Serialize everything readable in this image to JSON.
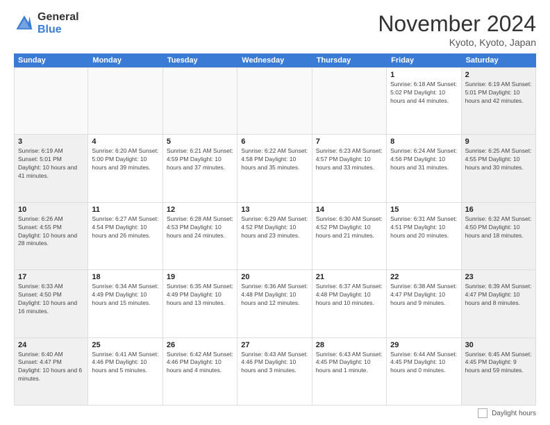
{
  "logo": {
    "general": "General",
    "blue": "Blue"
  },
  "header": {
    "month": "November 2024",
    "location": "Kyoto, Kyoto, Japan"
  },
  "weekdays": [
    "Sunday",
    "Monday",
    "Tuesday",
    "Wednesday",
    "Thursday",
    "Friday",
    "Saturday"
  ],
  "footer": {
    "legend_label": "Daylight hours"
  },
  "weeks": [
    [
      {
        "day": "",
        "info": "",
        "empty": true
      },
      {
        "day": "",
        "info": "",
        "empty": true
      },
      {
        "day": "",
        "info": "",
        "empty": true
      },
      {
        "day": "",
        "info": "",
        "empty": true
      },
      {
        "day": "",
        "info": "",
        "empty": true
      },
      {
        "day": "1",
        "info": "Sunrise: 6:18 AM\nSunset: 5:02 PM\nDaylight: 10 hours and 44 minutes.",
        "empty": false
      },
      {
        "day": "2",
        "info": "Sunrise: 6:19 AM\nSunset: 5:01 PM\nDaylight: 10 hours and 42 minutes.",
        "empty": false
      }
    ],
    [
      {
        "day": "3",
        "info": "Sunrise: 6:19 AM\nSunset: 5:01 PM\nDaylight: 10 hours and 41 minutes.",
        "empty": false
      },
      {
        "day": "4",
        "info": "Sunrise: 6:20 AM\nSunset: 5:00 PM\nDaylight: 10 hours and 39 minutes.",
        "empty": false
      },
      {
        "day": "5",
        "info": "Sunrise: 6:21 AM\nSunset: 4:59 PM\nDaylight: 10 hours and 37 minutes.",
        "empty": false
      },
      {
        "day": "6",
        "info": "Sunrise: 6:22 AM\nSunset: 4:58 PM\nDaylight: 10 hours and 35 minutes.",
        "empty": false
      },
      {
        "day": "7",
        "info": "Sunrise: 6:23 AM\nSunset: 4:57 PM\nDaylight: 10 hours and 33 minutes.",
        "empty": false
      },
      {
        "day": "8",
        "info": "Sunrise: 6:24 AM\nSunset: 4:56 PM\nDaylight: 10 hours and 31 minutes.",
        "empty": false
      },
      {
        "day": "9",
        "info": "Sunrise: 6:25 AM\nSunset: 4:55 PM\nDaylight: 10 hours and 30 minutes.",
        "empty": false
      }
    ],
    [
      {
        "day": "10",
        "info": "Sunrise: 6:26 AM\nSunset: 4:55 PM\nDaylight: 10 hours and 28 minutes.",
        "empty": false
      },
      {
        "day": "11",
        "info": "Sunrise: 6:27 AM\nSunset: 4:54 PM\nDaylight: 10 hours and 26 minutes.",
        "empty": false
      },
      {
        "day": "12",
        "info": "Sunrise: 6:28 AM\nSunset: 4:53 PM\nDaylight: 10 hours and 24 minutes.",
        "empty": false
      },
      {
        "day": "13",
        "info": "Sunrise: 6:29 AM\nSunset: 4:52 PM\nDaylight: 10 hours and 23 minutes.",
        "empty": false
      },
      {
        "day": "14",
        "info": "Sunrise: 6:30 AM\nSunset: 4:52 PM\nDaylight: 10 hours and 21 minutes.",
        "empty": false
      },
      {
        "day": "15",
        "info": "Sunrise: 6:31 AM\nSunset: 4:51 PM\nDaylight: 10 hours and 20 minutes.",
        "empty": false
      },
      {
        "day": "16",
        "info": "Sunrise: 6:32 AM\nSunset: 4:50 PM\nDaylight: 10 hours and 18 minutes.",
        "empty": false
      }
    ],
    [
      {
        "day": "17",
        "info": "Sunrise: 6:33 AM\nSunset: 4:50 PM\nDaylight: 10 hours and 16 minutes.",
        "empty": false
      },
      {
        "day": "18",
        "info": "Sunrise: 6:34 AM\nSunset: 4:49 PM\nDaylight: 10 hours and 15 minutes.",
        "empty": false
      },
      {
        "day": "19",
        "info": "Sunrise: 6:35 AM\nSunset: 4:49 PM\nDaylight: 10 hours and 13 minutes.",
        "empty": false
      },
      {
        "day": "20",
        "info": "Sunrise: 6:36 AM\nSunset: 4:48 PM\nDaylight: 10 hours and 12 minutes.",
        "empty": false
      },
      {
        "day": "21",
        "info": "Sunrise: 6:37 AM\nSunset: 4:48 PM\nDaylight: 10 hours and 10 minutes.",
        "empty": false
      },
      {
        "day": "22",
        "info": "Sunrise: 6:38 AM\nSunset: 4:47 PM\nDaylight: 10 hours and 9 minutes.",
        "empty": false
      },
      {
        "day": "23",
        "info": "Sunrise: 6:39 AM\nSunset: 4:47 PM\nDaylight: 10 hours and 8 minutes.",
        "empty": false
      }
    ],
    [
      {
        "day": "24",
        "info": "Sunrise: 6:40 AM\nSunset: 4:47 PM\nDaylight: 10 hours and 6 minutes.",
        "empty": false
      },
      {
        "day": "25",
        "info": "Sunrise: 6:41 AM\nSunset: 4:46 PM\nDaylight: 10 hours and 5 minutes.",
        "empty": false
      },
      {
        "day": "26",
        "info": "Sunrise: 6:42 AM\nSunset: 4:46 PM\nDaylight: 10 hours and 4 minutes.",
        "empty": false
      },
      {
        "day": "27",
        "info": "Sunrise: 6:43 AM\nSunset: 4:46 PM\nDaylight: 10 hours and 3 minutes.",
        "empty": false
      },
      {
        "day": "28",
        "info": "Sunrise: 6:43 AM\nSunset: 4:45 PM\nDaylight: 10 hours and 1 minute.",
        "empty": false
      },
      {
        "day": "29",
        "info": "Sunrise: 6:44 AM\nSunset: 4:45 PM\nDaylight: 10 hours and 0 minutes.",
        "empty": false
      },
      {
        "day": "30",
        "info": "Sunrise: 6:45 AM\nSunset: 4:45 PM\nDaylight: 9 hours and 59 minutes.",
        "empty": false
      }
    ]
  ]
}
